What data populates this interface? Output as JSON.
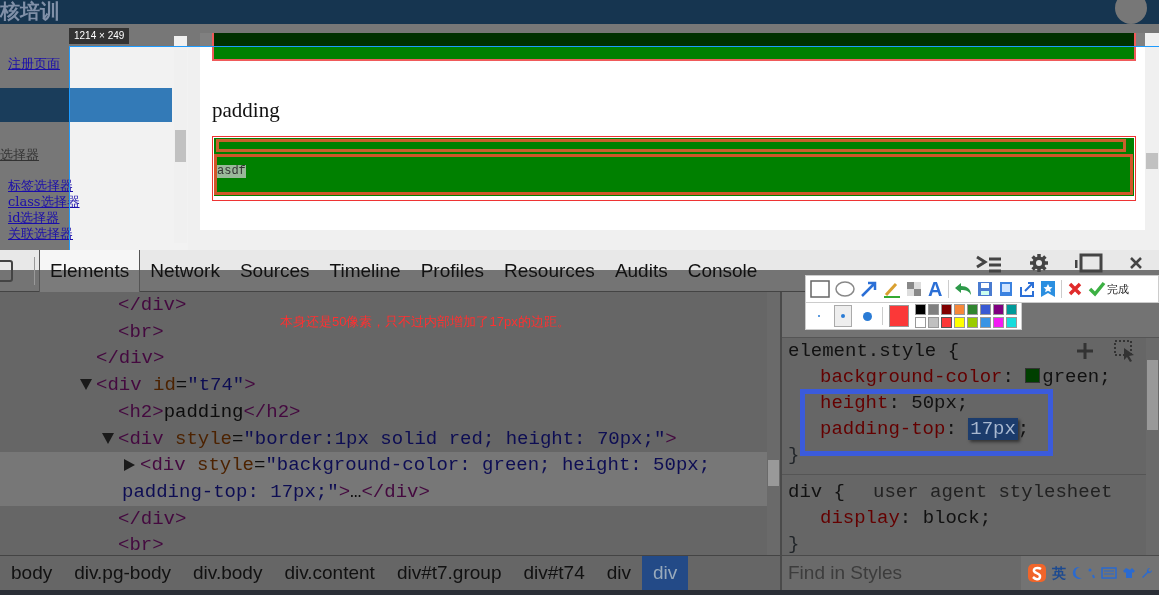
{
  "site_header": {
    "title": "核培训"
  },
  "sidebar": {
    "items": [
      {
        "kind": "link",
        "label": "注册页面"
      },
      {
        "kind": "bar"
      },
      {
        "kind": "heading",
        "label": "选择器"
      },
      {
        "kind": "sublink",
        "label": "标签选择器"
      },
      {
        "kind": "sublink",
        "label": "class选择器"
      },
      {
        "kind": "sublink",
        "label": "id选择器"
      },
      {
        "kind": "sublink",
        "label": "关联选择器"
      }
    ]
  },
  "preview": {
    "blocks": [
      {
        "kind": "box"
      },
      {
        "kind": "heading",
        "text": "padding"
      },
      {
        "kind": "padded_box",
        "text": "asdf"
      }
    ]
  },
  "selection": {
    "size": "1214 × 249"
  },
  "devtools": {
    "tabs": [
      {
        "label": "Elements",
        "selected": true
      },
      {
        "label": "Network",
        "selected": false
      },
      {
        "label": "Sources",
        "selected": false
      },
      {
        "label": "Timeline",
        "selected": false
      },
      {
        "label": "Profiles",
        "selected": false
      },
      {
        "label": "Resources",
        "selected": false
      },
      {
        "label": "Audits",
        "selected": false
      },
      {
        "label": "Console",
        "selected": false
      }
    ],
    "dom_tree": [
      {
        "children": [
          {
            "text": "</div>",
            "selected": false
          },
          {
            "text": "<br>",
            "selected": false
          }
        ],
        "close": "</div>"
      },
      {
        "text": "<div id=\"t74\">",
        "expanded": true,
        "selected": false,
        "children": [
          {
            "text": "<h2>padding</h2>",
            "selected": false
          },
          {
            "text": "<div style=\"border:1px solid red; height: 70px;\">",
            "expanded": true,
            "selected": false,
            "children": [
              {
                "text": "<div style=\"background-color: green; height: 50px; padding-top: 17px;\">…</div>",
                "expanded": false,
                "selected": true
              }
            ],
            "close": "</div>"
          },
          {
            "text": "<br>",
            "selected": false
          }
        ]
      }
    ],
    "styles": {
      "rules": [
        {
          "selector": "element.style {",
          "declarations": [
            {
              "text": "background-color: green;",
              "color": "#003f00"
            },
            {
              "text": "height: 50px;"
            },
            {
              "text": "padding-top: 17px;",
              "editing": true
            }
          ],
          "close": "}"
        },
        {
          "selector": "div {",
          "origin": "user agent stylesheet",
          "declarations": [
            {
              "text": "display: block;"
            }
          ],
          "close": "}"
        }
      ],
      "filter_placeholder": "Find in Styles"
    },
    "breadcrumbs": [
      {
        "label": "body",
        "selected": false
      },
      {
        "label": "div.pg-body",
        "selected": false
      },
      {
        "label": "div.body",
        "selected": false
      },
      {
        "label": "div.content",
        "selected": false
      },
      {
        "label": "div#t7.group",
        "selected": false
      },
      {
        "label": "div#t74",
        "selected": false
      },
      {
        "label": "div",
        "selected": false
      },
      {
        "label": "div",
        "selected": true
      }
    ]
  },
  "annotation": {
    "note": "本身还是50像素，只不过内部增加了17px的边距。"
  },
  "capture_toolbar": {
    "text_tool": "A",
    "done": "完成",
    "pen_sizes": [
      {
        "selected": false
      },
      {
        "selected": true
      },
      {
        "selected": false
      }
    ],
    "palette": [
      {
        "color": "#000000",
        "selected": false
      },
      {
        "color": "#808080",
        "selected": false
      },
      {
        "color": "#800000",
        "selected": false
      },
      {
        "color": "#f7883a",
        "selected": false
      },
      {
        "color": "#308430",
        "selected": false
      },
      {
        "color": "#385ad3",
        "selected": false
      },
      {
        "color": "#800080",
        "selected": false
      },
      {
        "color": "#009999",
        "selected": false
      },
      {
        "color": "#ffffff",
        "selected": false
      },
      {
        "color": "#c0c0c0",
        "selected": false
      },
      {
        "color": "#fb3838",
        "selected": true
      },
      {
        "color": "#ffff00",
        "selected": false
      },
      {
        "color": "#99cc00",
        "selected": false
      },
      {
        "color": "#3894e4",
        "selected": false
      },
      {
        "color": "#f31bf3",
        "selected": false
      },
      {
        "color": "#16dcdc",
        "selected": false
      }
    ]
  },
  "ime_bar": {
    "mode": "英"
  }
}
